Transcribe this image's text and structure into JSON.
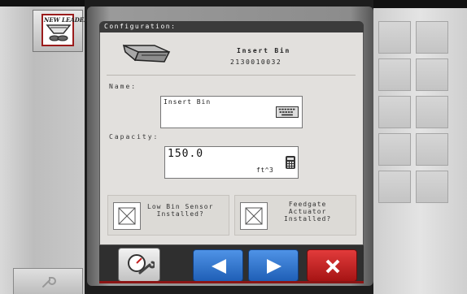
{
  "left_panel": {
    "app_button": {
      "brand_text": "NEW LEADER",
      "icon": "spreader-bin-icon"
    },
    "tools_button": {
      "icon": "wrench-icon"
    }
  },
  "dialog": {
    "title": "Configuration:",
    "product": {
      "icon": "insert-bin-icon",
      "name": "Insert Bin",
      "number": "2130010032"
    },
    "name_field": {
      "label": "Name:",
      "value": "Insert Bin",
      "icon": "keyboard-icon"
    },
    "capacity_field": {
      "label": "Capacity:",
      "value": "150.0",
      "unit": "ft^3",
      "icon": "calculator-icon"
    },
    "checkboxes": [
      {
        "label": "Low Bin Sensor\nInstalled?",
        "checked": false
      },
      {
        "label": "Feedgate\nActuator\nInstalled?",
        "checked": false
      }
    ]
  },
  "bottom_buttons": {
    "settings": {
      "icon": "settings-gauge-wrench-icon"
    },
    "back": {
      "icon": "left-arrow-icon"
    },
    "next": {
      "icon": "right-arrow-icon"
    },
    "close": {
      "icon": "close-x-icon"
    }
  },
  "colors": {
    "accent_blue": "#2e73d0",
    "close_red": "#c42222",
    "brand_red": "#9b1c1c"
  }
}
